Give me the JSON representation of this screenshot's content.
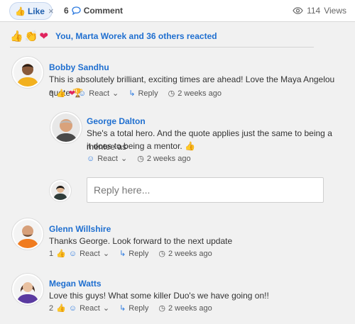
{
  "topbar": {
    "like_label": "Like",
    "like_clear": "×",
    "comment_count": "6",
    "comment_label": "Comment",
    "views_count": "114",
    "views_label": "Views"
  },
  "reactions_summary": {
    "text": "You, Marta Worek and 36 others reacted",
    "icons": [
      "thumbs-up-icon",
      "clap-icon",
      "heart-icon"
    ]
  },
  "comments": [
    {
      "author": "Bobby Sandhu",
      "text": "This is absolutely brilliant, exciting times are ahead! Love the Maya Angelou quote 🏆",
      "reaction_count": "3",
      "react_label": "React",
      "reply_label": "Reply",
      "time": "2 weeks ago"
    },
    {
      "author": "George Dalton",
      "text_line1": "She's a total hero. And the quote applies just the same to being a mentee as",
      "text_line2": "it does to being a mentor. 👍",
      "react_label": "React",
      "time": "2 weeks ago"
    },
    {
      "author": "Glenn Willshire",
      "text": "Thanks George. Look forward to the next update",
      "reaction_count": "1",
      "react_label": "React",
      "reply_label": "Reply",
      "time": "2 weeks ago"
    },
    {
      "author": "Megan Watts",
      "text": "Love this guys! What some killer Duo's we have going on!!",
      "reaction_count": "2",
      "react_label": "React",
      "reply_label": "Reply",
      "time": "2 weeks ago"
    }
  ],
  "reply_box": {
    "placeholder": "Reply here..."
  }
}
